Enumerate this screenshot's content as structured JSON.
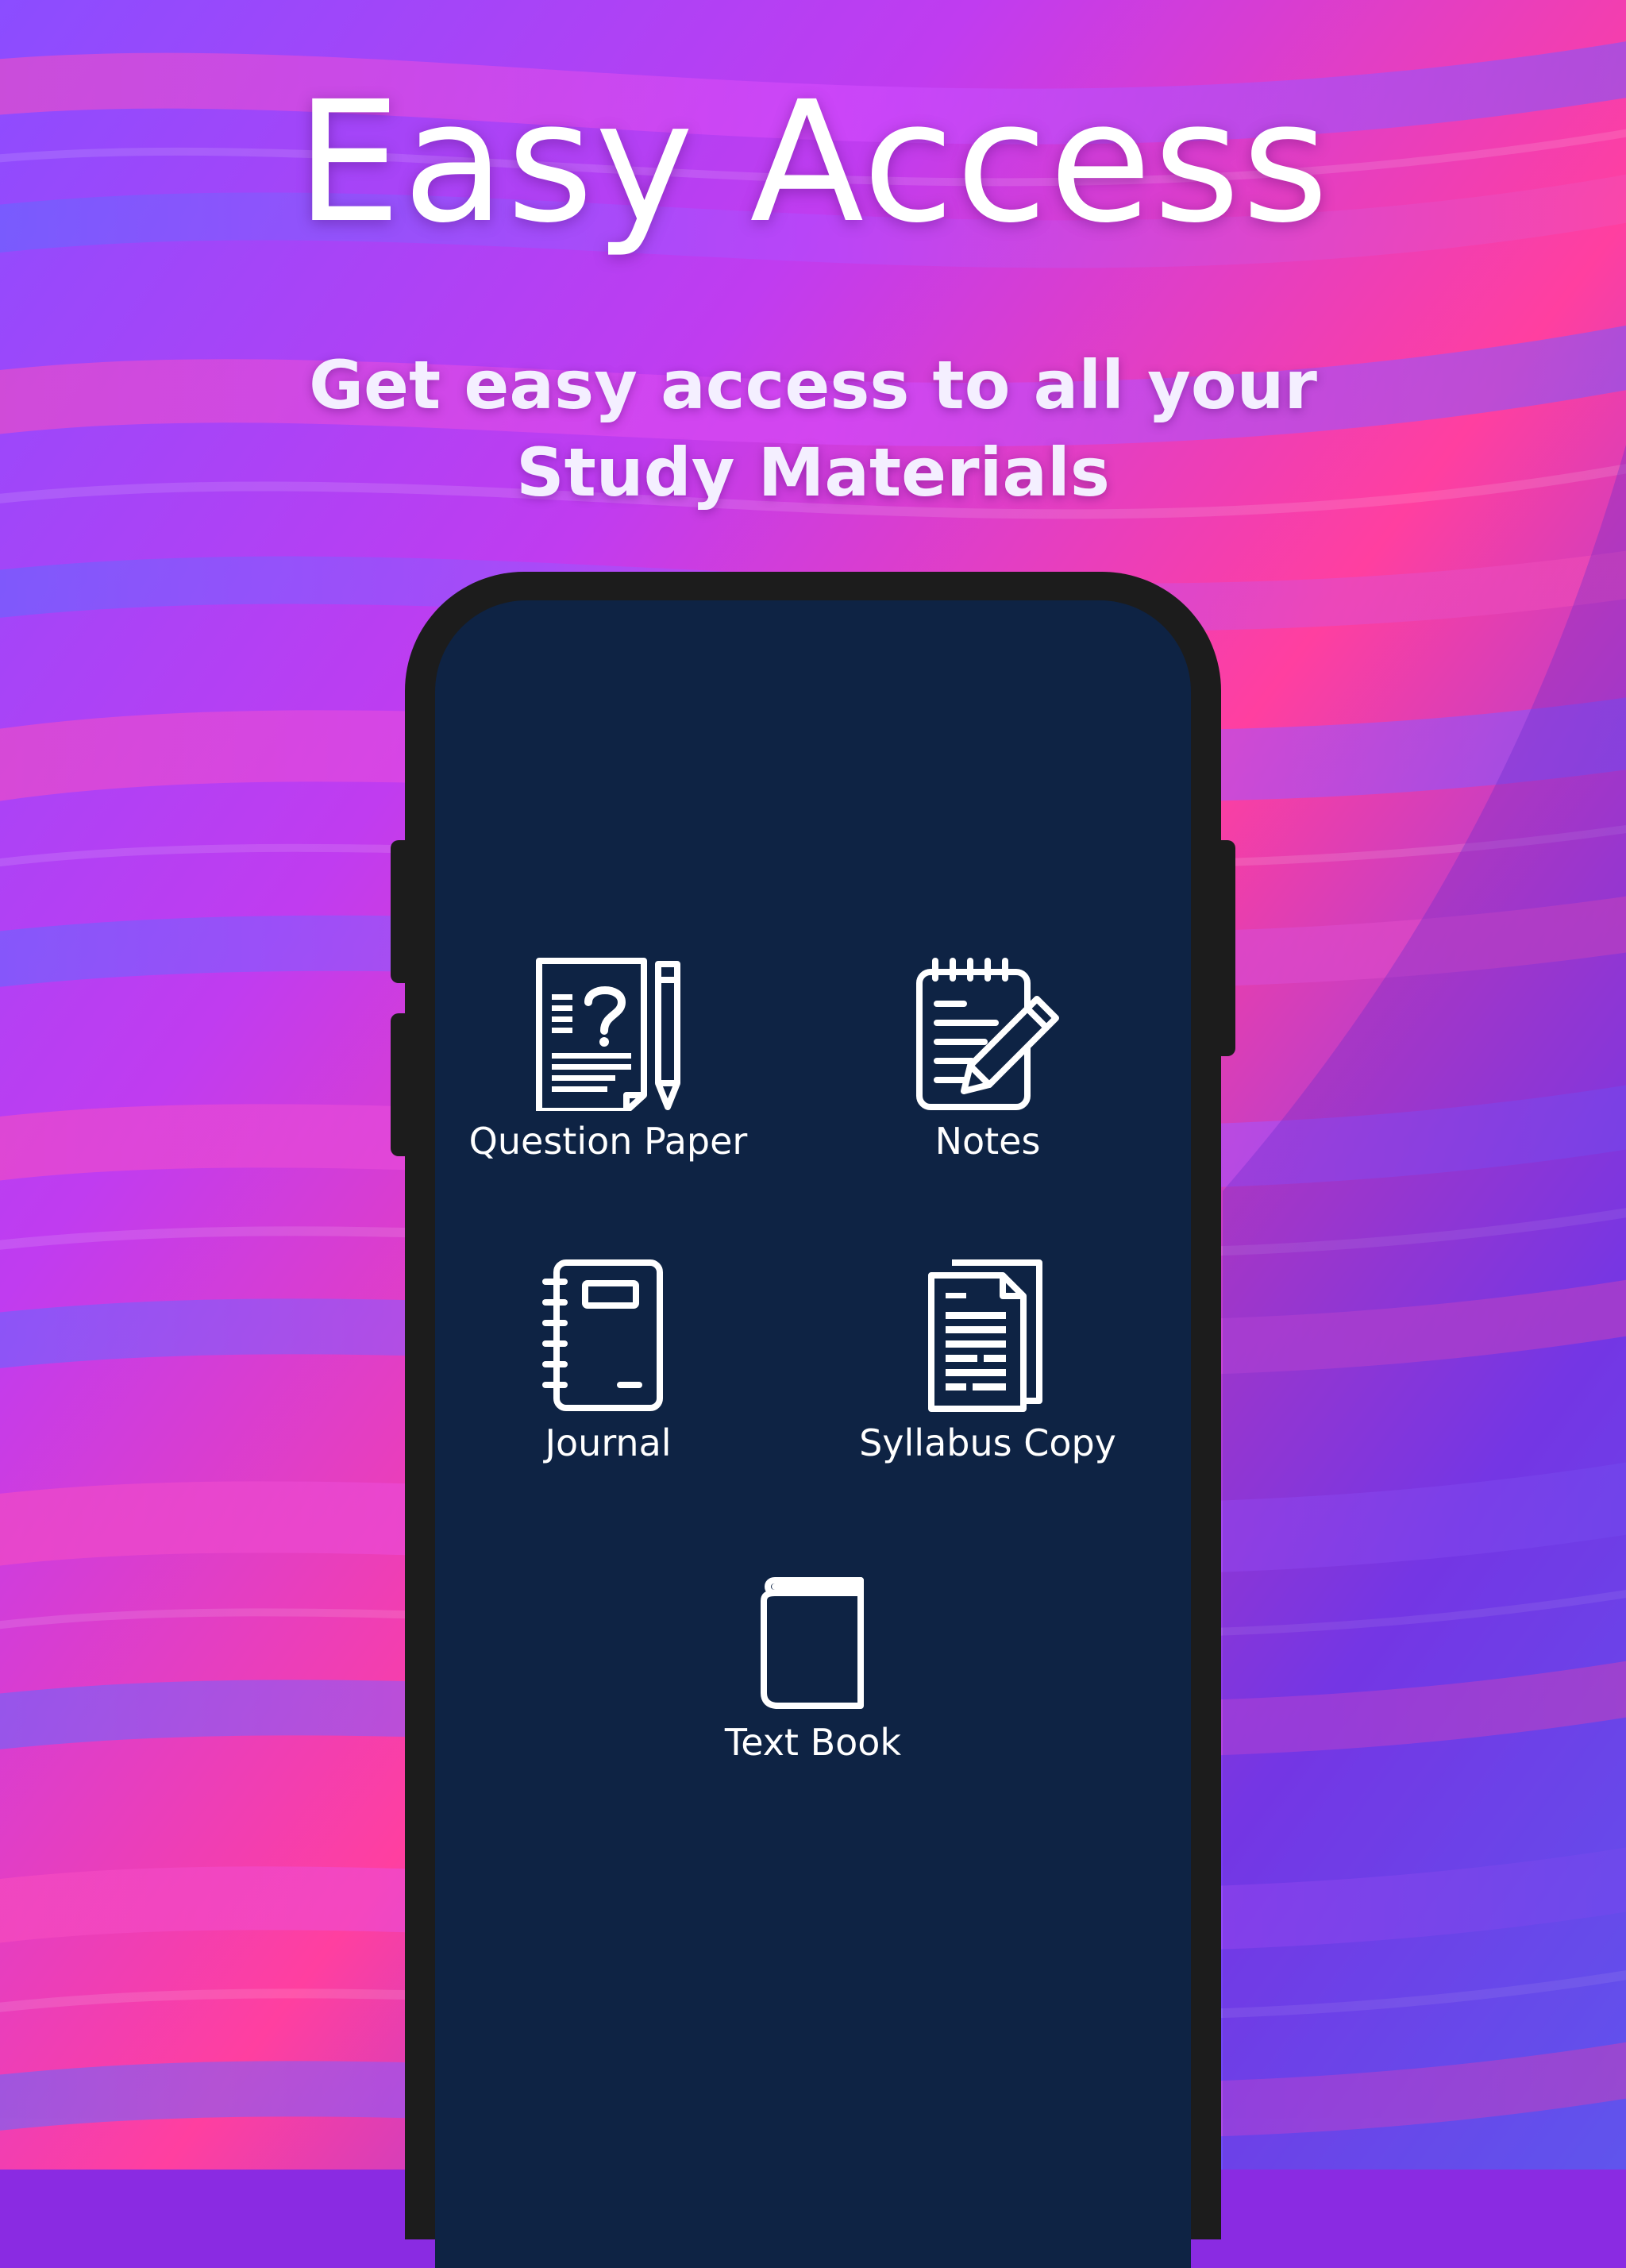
{
  "hero": {
    "title": "Easy Access",
    "subtitle_line1": "Get easy access to all your",
    "subtitle_line2": "Study Materials"
  },
  "menu": {
    "items": [
      {
        "label": "Question Paper",
        "icon": "question-paper-icon"
      },
      {
        "label": "Notes",
        "icon": "notes-icon"
      },
      {
        "label": "Journal",
        "icon": "journal-icon"
      },
      {
        "label": "Syllabus Copy",
        "icon": "syllabus-copy-icon"
      },
      {
        "label": "Text Book",
        "icon": "text-book-icon"
      }
    ]
  },
  "colors": {
    "screen_background": "#0e2344",
    "phone_frame": "#1c1c1c",
    "text": "#ffffff"
  }
}
